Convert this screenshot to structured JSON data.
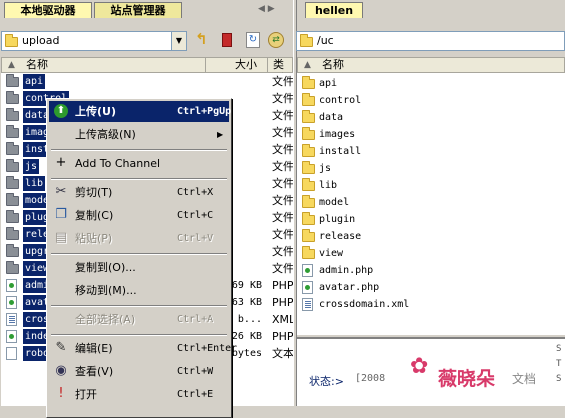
{
  "left_tabs": [
    "本地驱动器",
    "站点管理器"
  ],
  "right_tab": "hellen",
  "left_path": "upload",
  "right_path": "/uc",
  "columns": {
    "name": "名称",
    "size": "大小",
    "type": "类型"
  },
  "left_rows": [
    {
      "name": "api",
      "size": "",
      "type": "文件",
      "kind": "folder"
    },
    {
      "name": "control",
      "size": "",
      "type": "文件",
      "kind": "folder"
    },
    {
      "name": "data",
      "size": "",
      "type": "文件",
      "kind": "folder"
    },
    {
      "name": "images",
      "size": "",
      "type": "文件",
      "kind": "folder"
    },
    {
      "name": "install",
      "size": "",
      "type": "文件",
      "kind": "folder"
    },
    {
      "name": "js",
      "size": "",
      "type": "文件",
      "kind": "folder"
    },
    {
      "name": "lib",
      "size": "",
      "type": "文件",
      "kind": "folder"
    },
    {
      "name": "model",
      "size": "",
      "type": "文件",
      "kind": "folder"
    },
    {
      "name": "plugin",
      "size": "",
      "type": "文件",
      "kind": "folder"
    },
    {
      "name": "release",
      "size": "",
      "type": "文件",
      "kind": "folder"
    },
    {
      "name": "upgrade",
      "size": "",
      "type": "文件",
      "kind": "folder"
    },
    {
      "name": "view",
      "size": "",
      "type": "文件",
      "kind": "folder"
    },
    {
      "name": "admin.php",
      "size": "69 KB",
      "type": "PHP",
      "kind": "php"
    },
    {
      "name": "avatar.php",
      "size": "63 KB",
      "type": "PHP",
      "kind": "php"
    },
    {
      "name": "crossdomain.xml",
      "size": "b...",
      "type": "XML",
      "kind": "xml"
    },
    {
      "name": "index.php",
      "size": "26 KB",
      "type": "PHP",
      "kind": "php"
    },
    {
      "name": "robots.txt",
      "size": "bytes",
      "type": "文本",
      "kind": "txt"
    }
  ],
  "right_rows": [
    {
      "name": "api",
      "kind": "folder"
    },
    {
      "name": "control",
      "kind": "folder"
    },
    {
      "name": "data",
      "kind": "folder"
    },
    {
      "name": "images",
      "kind": "folder"
    },
    {
      "name": "install",
      "kind": "folder"
    },
    {
      "name": "js",
      "kind": "folder"
    },
    {
      "name": "lib",
      "kind": "folder"
    },
    {
      "name": "model",
      "kind": "folder"
    },
    {
      "name": "plugin",
      "kind": "folder"
    },
    {
      "name": "release",
      "kind": "folder"
    },
    {
      "name": "view",
      "kind": "folder"
    },
    {
      "name": "admin.php",
      "kind": "php"
    },
    {
      "name": "avatar.php",
      "kind": "php"
    },
    {
      "name": "crossdomain.xml",
      "kind": "xml"
    }
  ],
  "context_menu": [
    {
      "label": "上传(U)",
      "shortcut": "Ctrl+PgUp",
      "state": "selected",
      "icon": "upload-arrow-icon"
    },
    {
      "label": "上传高级(N)",
      "shortcut": "",
      "state": "submenu",
      "icon": ""
    },
    {
      "sep": true
    },
    {
      "label": "Add To Channel",
      "shortcut": "",
      "state": "normal",
      "icon": "plus-icon"
    },
    {
      "sep": true
    },
    {
      "label": "剪切(T)",
      "shortcut": "Ctrl+X",
      "state": "normal",
      "icon": "scissors-icon"
    },
    {
      "label": "复制(C)",
      "shortcut": "Ctrl+C",
      "state": "normal",
      "icon": "copy-icon"
    },
    {
      "label": "粘贴(P)",
      "shortcut": "Ctrl+V",
      "state": "disabled",
      "icon": "paste-icon"
    },
    {
      "sep": true
    },
    {
      "label": "复制到(O)...",
      "shortcut": "",
      "state": "normal",
      "icon": ""
    },
    {
      "label": "移动到(M)...",
      "shortcut": "",
      "state": "normal",
      "icon": ""
    },
    {
      "sep": true
    },
    {
      "label": "全部选择(A)",
      "shortcut": "Ctrl+A",
      "state": "disabled",
      "icon": ""
    },
    {
      "sep": true
    },
    {
      "label": "编辑(E)",
      "shortcut": "Ctrl+Enter",
      "state": "normal",
      "icon": "edit-icon"
    },
    {
      "label": "查看(V)",
      "shortcut": "Ctrl+W",
      "state": "normal",
      "icon": "view-icon"
    },
    {
      "label": "打开",
      "shortcut": "Ctrl+E",
      "state": "normal",
      "icon": "open-icon"
    }
  ],
  "status": {
    "label": "状态:>",
    "value": "[2008"
  },
  "watermark": {
    "text": "薇晓朵",
    "suffix": "文档"
  },
  "colors": {
    "selection": "#0a246a",
    "tab_active": "#fff8b0",
    "panel": "#d4d0c8"
  }
}
